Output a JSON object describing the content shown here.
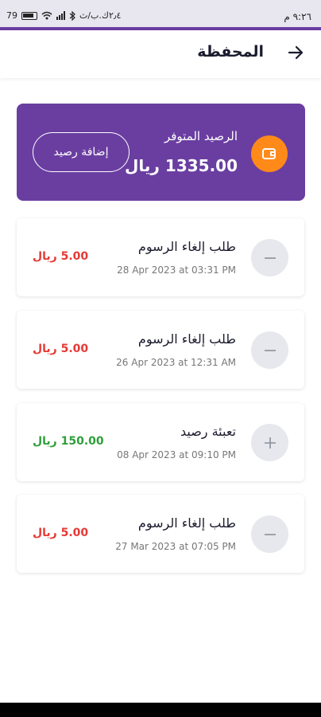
{
  "status_bar": {
    "time": "٩:٢٦ م",
    "network_speed": "٢٫٤ك.ب/ث",
    "battery": "79"
  },
  "header": {
    "title": "المحفظة"
  },
  "wallet": {
    "balance_label": "الرصيد المتوفر",
    "balance_value": "1335.00 ريال",
    "add_button": "إضافة رصيد"
  },
  "transactions": [
    {
      "title": "طلب إلغاء الرسوم",
      "date": "28 Apr 2023 at 03:31 PM",
      "amount": "5.00 ريال",
      "type": "minus",
      "amount_color": "#e53935"
    },
    {
      "title": "طلب إلغاء الرسوم",
      "date": "26 Apr 2023 at 12:31 AM",
      "amount": "5.00 ريال",
      "type": "minus",
      "amount_color": "#e53935"
    },
    {
      "title": "تعبئة رصيد",
      "date": "08 Apr 2023 at 09:10 PM",
      "amount": "150.00 ريال",
      "type": "plus",
      "amount_color": "#2e9e3a"
    },
    {
      "title": "طلب إلغاء الرسوم",
      "date": "27 Mar 2023 at 07:05 PM",
      "amount": "5.00 ريال",
      "type": "minus",
      "amount_color": "#e53935"
    }
  ],
  "colors": {
    "primary": "#6a3ea1",
    "accent": "#ff8a1a",
    "debit": "#e53935",
    "credit": "#2e9e3a"
  }
}
